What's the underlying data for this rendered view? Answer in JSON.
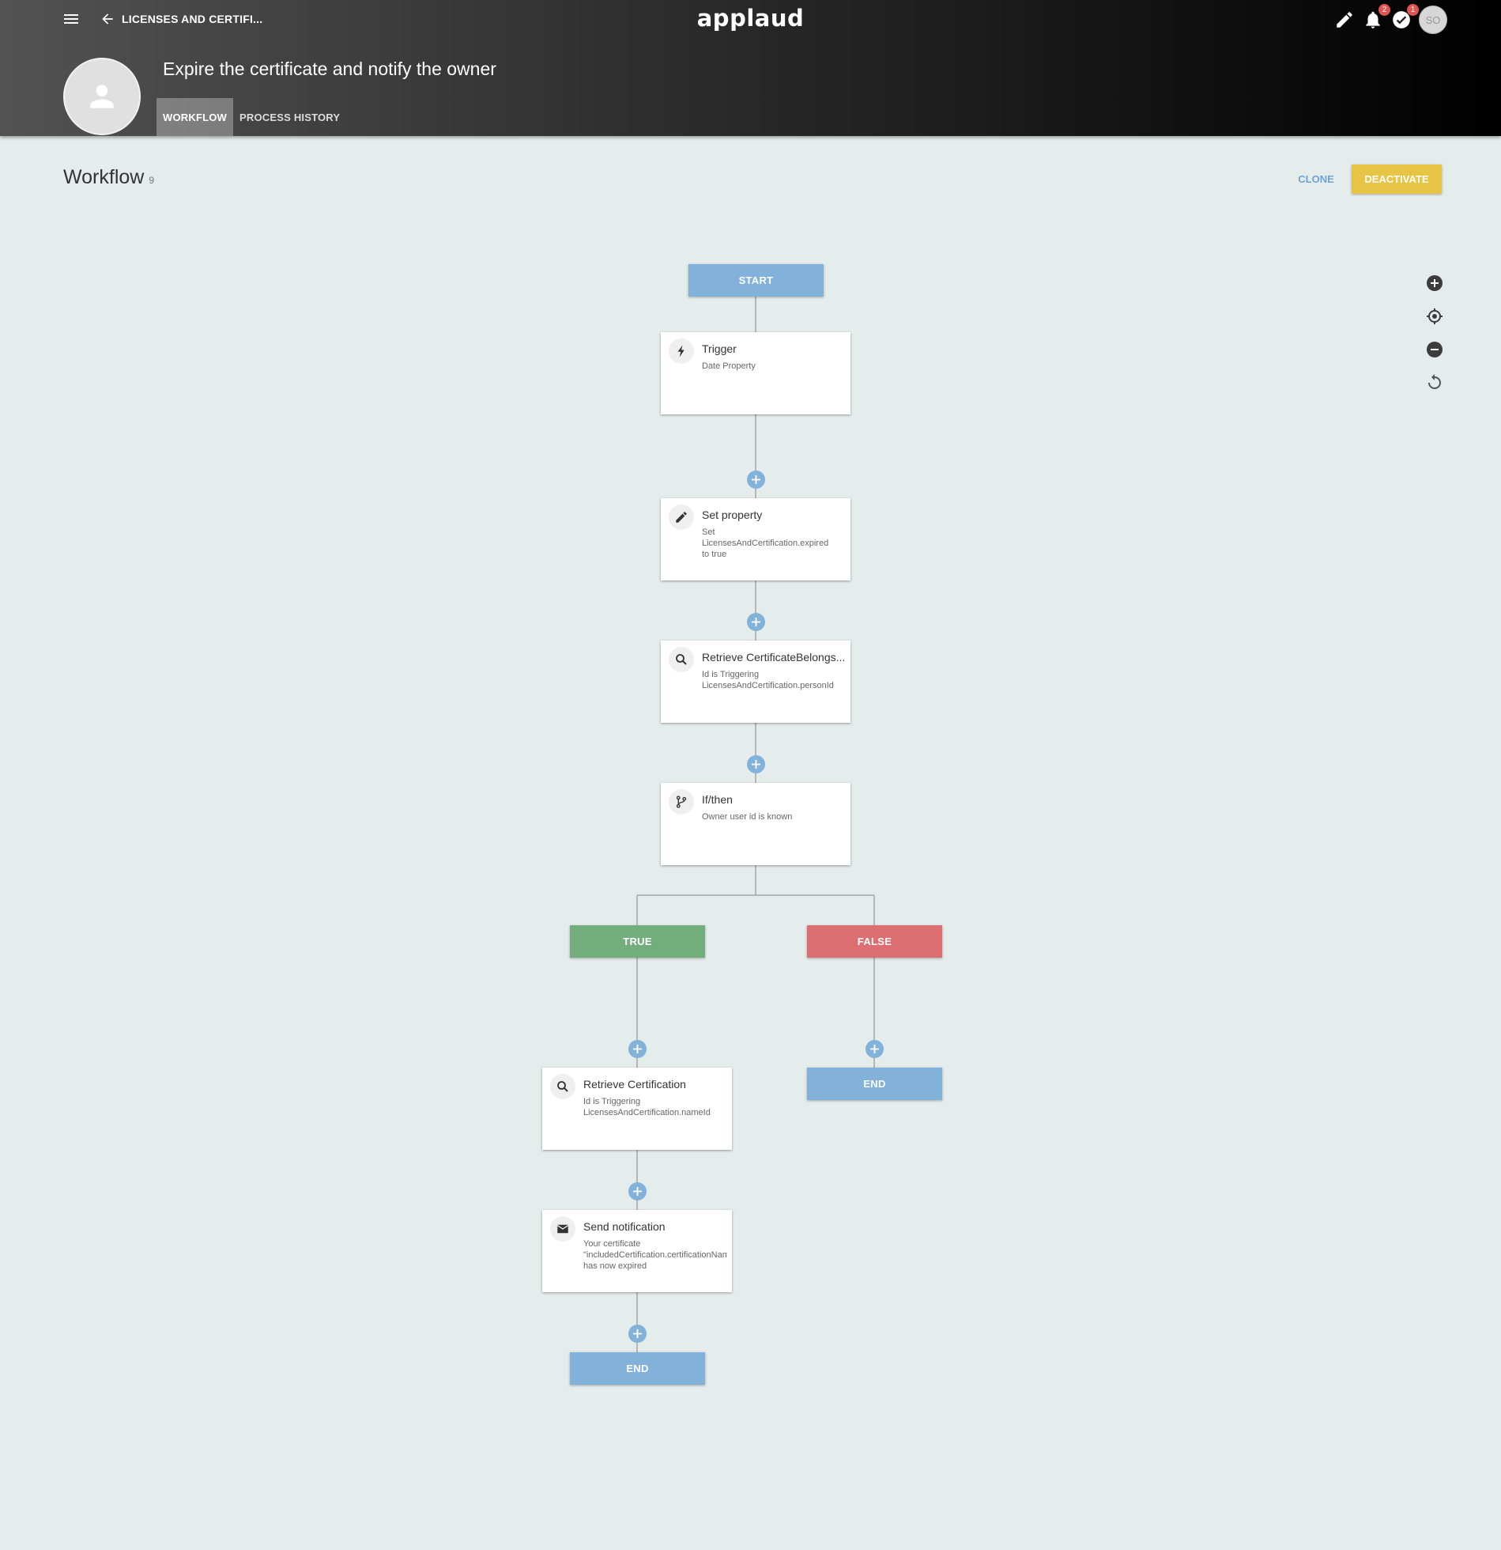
{
  "header": {
    "back_label": "LICENSES AND CERTIFI...",
    "brand": "applaud",
    "notifications_count": "2",
    "tasks_count": "1",
    "user_initials": "SO",
    "page_title": "Expire the certificate and notify the owner",
    "tabs": [
      {
        "label": "WORKFLOW",
        "active": true
      },
      {
        "label": "PROCESS HISTORY",
        "active": false
      }
    ]
  },
  "section": {
    "title": "Workflow",
    "count": "9",
    "clone_label": "CLONE",
    "deactivate_label": "DEACTIVATE"
  },
  "colors": {
    "accent_blue": "#82b1da",
    "true_green": "#72ad7c",
    "false_red": "#dd6f72",
    "deactivate_yellow": "#e8c444",
    "background": "#e5ecec"
  },
  "zoom_controls": [
    "zoom-in-icon",
    "recenter-icon",
    "zoom-out-icon",
    "reset-icon"
  ],
  "workflow": {
    "start": "START",
    "trigger": {
      "title": "Trigger",
      "desc": [
        "Date Property"
      ],
      "icon": "lightning-icon"
    },
    "set_property": {
      "title": "Set property",
      "desc": [
        "Set",
        "LicensesAndCertification.expired",
        "to true"
      ],
      "icon": "pencil-icon"
    },
    "retrieve_belongs": {
      "title": "Retrieve CertificateBelongs...",
      "desc": [
        "Id is Triggering",
        "LicensesAndCertification.personId"
      ],
      "icon": "search-icon"
    },
    "if_then": {
      "title": "If/then",
      "desc": [
        "Owner user id is known"
      ],
      "icon": "branch-icon"
    },
    "true_label": "TRUE",
    "false_label": "FALSE",
    "retrieve_cert": {
      "title": "Retrieve Certification",
      "desc": [
        "Id is Triggering",
        "LicensesAndCertification.nameId"
      ],
      "icon": "search-icon"
    },
    "send_notification": {
      "title": "Send notification",
      "desc": [
        "Your certificate",
        "\"includedCertification.certificationName\"",
        "has now expired"
      ],
      "icon": "envelope-icon"
    },
    "end_false": "END",
    "end_true": "END"
  }
}
